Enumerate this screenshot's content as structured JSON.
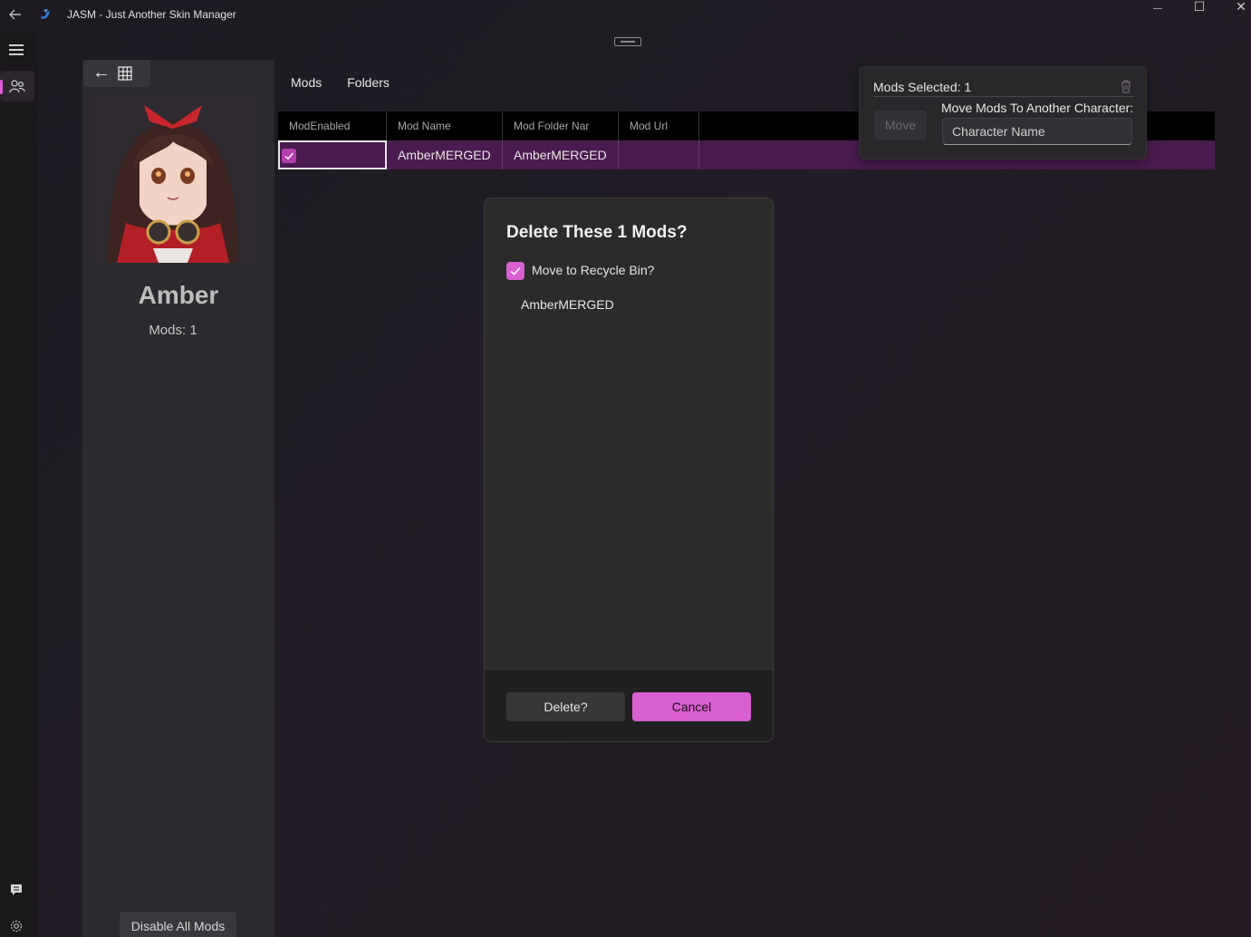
{
  "window": {
    "title": "JASM - Just Another Skin Manager",
    "back_icon": "back-arrow-icon",
    "logo_icon": "jasm-logo-icon",
    "minimize_glyph": "—",
    "maximize_glyph": "☐",
    "close_glyph": "✕"
  },
  "nav_rail": {
    "items": [
      {
        "icon": "hamburger-menu-icon"
      },
      {
        "icon": "characters-icon",
        "selected": true
      }
    ],
    "footer": [
      {
        "icon": "feedback-icon"
      },
      {
        "icon": "settings-icon"
      }
    ]
  },
  "character": {
    "nav_back_glyph": "←",
    "name": "Amber",
    "mods_count_label": "Mods: 1",
    "disable_all_label": "Disable All Mods"
  },
  "tabs": [
    {
      "label": "Mods",
      "selected": true
    },
    {
      "label": "Folders",
      "selected": false
    }
  ],
  "mods_table": {
    "columns": [
      "ModEnabled",
      "Mod Name",
      "Mod Folder Nar",
      "Mod Url"
    ],
    "rows": [
      {
        "enabled": true,
        "name": "AmberMERGED",
        "folder": "AmberMERGED",
        "url": ""
      }
    ]
  },
  "selection_flyout": {
    "count_label": "Mods Selected: 1",
    "move_label": "Move",
    "move_to_label": "Move Mods To Another Character:",
    "character_input_placeholder": "Character Name"
  },
  "delete_dialog": {
    "title": "Delete These 1 Mods?",
    "recycle_label": "Move to Recycle Bin?",
    "recycle_checked": true,
    "items": [
      "AmberMERGED"
    ],
    "delete_label": "Delete?",
    "cancel_label": "Cancel"
  },
  "colors": {
    "accent": "#d960d1",
    "selected_row": "#4a1b4f",
    "dialog_bg": "#2b2b2b"
  }
}
